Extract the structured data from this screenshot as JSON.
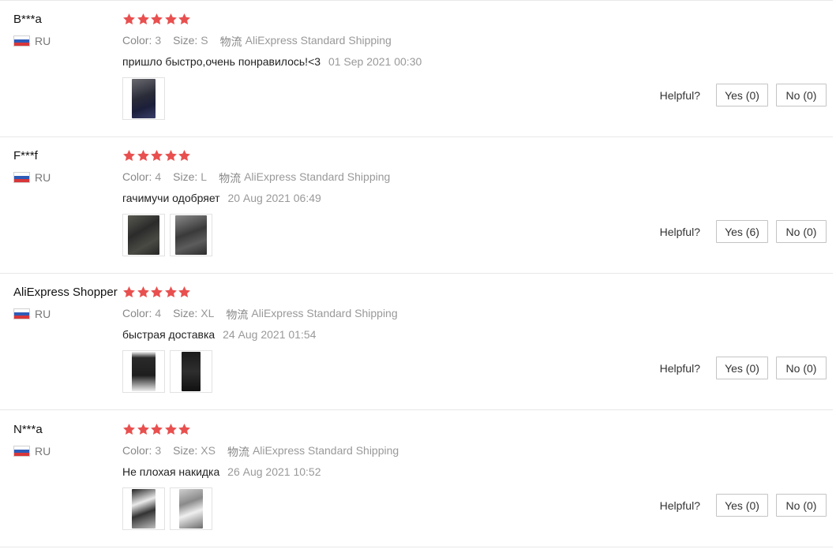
{
  "star_color": "#e8504f",
  "labels": {
    "color": "Color:",
    "size": "Size:",
    "shipping_prefix": "物流",
    "helpful": "Helpful?"
  },
  "reviews": [
    {
      "user": "B***a",
      "country": "RU",
      "rating": 5,
      "color": "3",
      "size": "S",
      "shipping": "AliExpress Standard Shipping",
      "text": "пришло быстро,очень понравилось!<3",
      "date": "01 Sep 2021 00:30",
      "yes": "Yes (0)",
      "no": "No (0)"
    },
    {
      "user": "F***f",
      "country": "RU",
      "rating": 5,
      "color": "4",
      "size": "L",
      "shipping": "AliExpress Standard Shipping",
      "text": "гачимучи одобряет",
      "date": "20 Aug 2021 06:49",
      "yes": "Yes (6)",
      "no": "No (0)"
    },
    {
      "user": "AliExpress Shopper",
      "country": "RU",
      "rating": 5,
      "color": "4",
      "size": "XL",
      "shipping": "AliExpress Standard Shipping",
      "text": "быстрая доставка",
      "date": "24 Aug 2021 01:54",
      "yes": "Yes (0)",
      "no": "No (0)"
    },
    {
      "user": "N***a",
      "country": "RU",
      "rating": 5,
      "color": "3",
      "size": "XS",
      "shipping": "AliExpress Standard Shipping",
      "text": "Не плохая накидка",
      "date": "26 Aug 2021 10:52",
      "yes": "Yes (0)",
      "no": "No (0)"
    }
  ]
}
